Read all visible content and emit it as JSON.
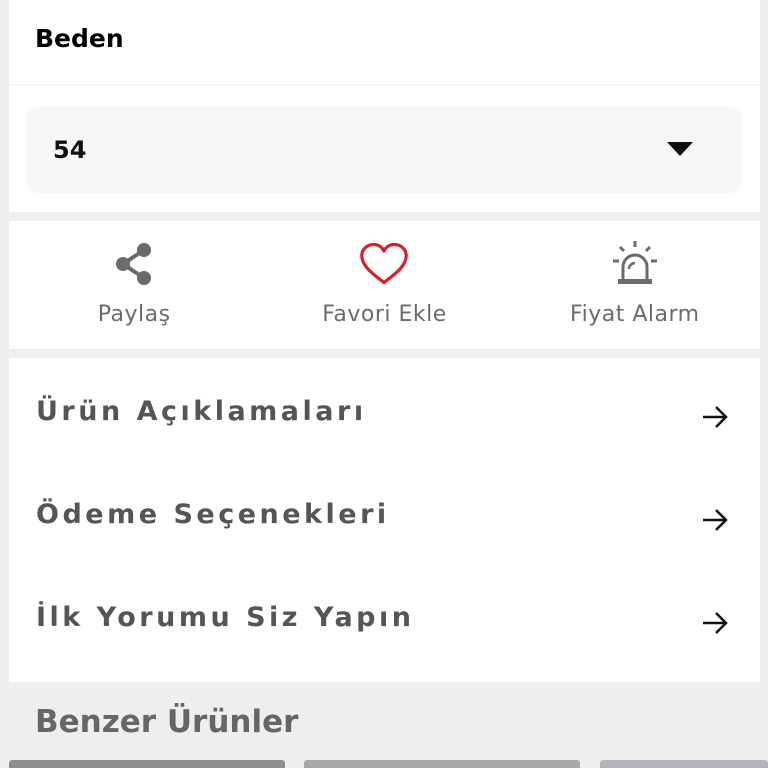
{
  "size": {
    "title": "Beden",
    "selected": "54"
  },
  "actions": [
    {
      "label": "Paylaş",
      "icon": "share-icon"
    },
    {
      "label": "Favori Ekle",
      "icon": "heart-outline-icon"
    },
    {
      "label": "Fiyat Alarm",
      "icon": "alarm-siren-icon"
    }
  ],
  "menu": [
    {
      "label": "Ürün Açıklamaları",
      "icon": "arrow-right-icon"
    },
    {
      "label": "Ödeme Seçenekleri",
      "icon": "arrow-right-icon"
    },
    {
      "label": "İlk Yorumu Siz Yapın",
      "icon": "arrow-right-icon"
    }
  ],
  "similar": {
    "title": "Benzer Ürünler"
  },
  "colors": {
    "favorite_red": "#d8202a",
    "icon_gray": "#6b6b6b",
    "background": "#eeeeee"
  }
}
